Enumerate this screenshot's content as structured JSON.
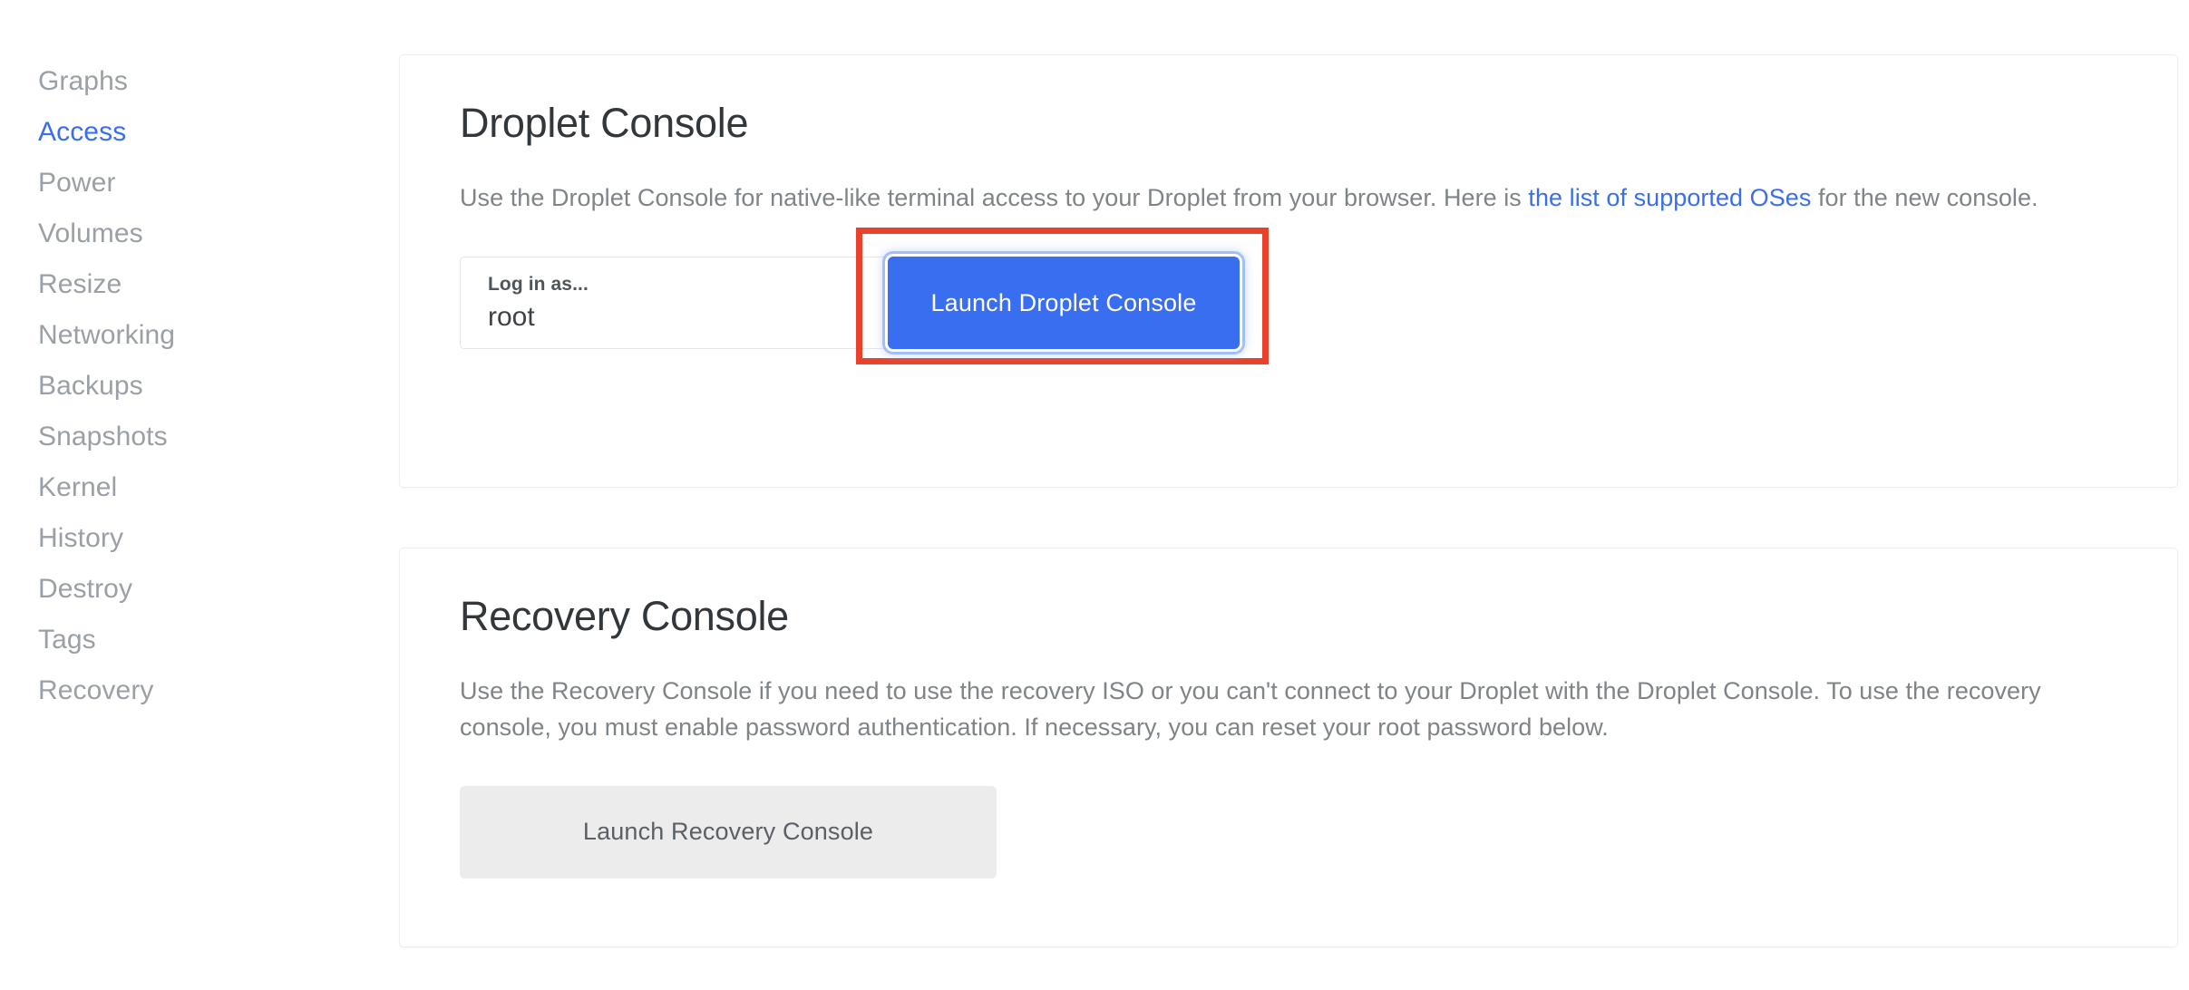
{
  "sidebar": {
    "items": [
      {
        "label": "Graphs",
        "active": false
      },
      {
        "label": "Access",
        "active": true
      },
      {
        "label": "Power",
        "active": false
      },
      {
        "label": "Volumes",
        "active": false
      },
      {
        "label": "Resize",
        "active": false
      },
      {
        "label": "Networking",
        "active": false
      },
      {
        "label": "Backups",
        "active": false
      },
      {
        "label": "Snapshots",
        "active": false
      },
      {
        "label": "Kernel",
        "active": false
      },
      {
        "label": "History",
        "active": false
      },
      {
        "label": "Destroy",
        "active": false
      },
      {
        "label": "Tags",
        "active": false
      },
      {
        "label": "Recovery",
        "active": false
      }
    ]
  },
  "droplet_console": {
    "title": "Droplet Console",
    "desc_part1": "Use the Droplet Console for native-like terminal access to your Droplet from your browser. Here is ",
    "desc_link": "the list of supported OSes",
    "desc_part2": " for the new console.",
    "login_label": "Log in as...",
    "login_value": "root",
    "launch_button": "Launch Droplet Console"
  },
  "recovery_console": {
    "title": "Recovery Console",
    "description": "Use the Recovery Console if you need to use the recovery ISO or you can't connect to your Droplet with the Droplet Console. To use the recovery console, you must enable password authentication. If necessary, you can reset your root password below.",
    "launch_button": "Launch Recovery Console"
  },
  "colors": {
    "accent_blue": "#3a6ef0",
    "annotation_red": "#e8432a",
    "muted_text": "#9aa0a6",
    "body_text": "#7f8488",
    "heading_text": "#32373c",
    "secondary_button_bg": "#ececec"
  }
}
